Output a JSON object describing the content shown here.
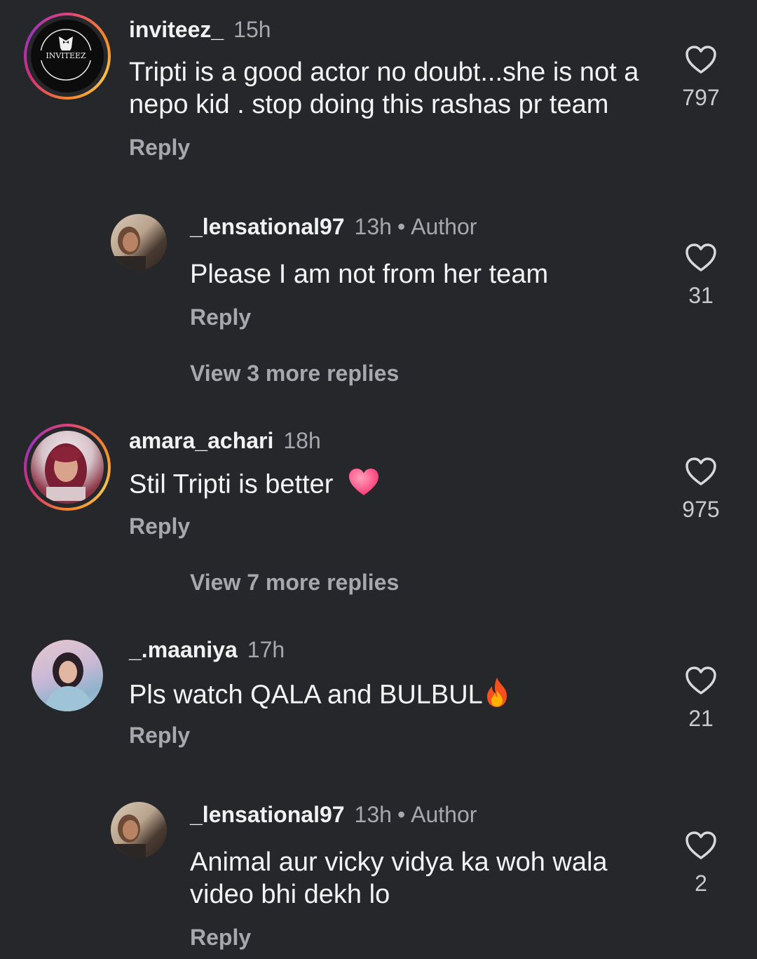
{
  "comments": [
    {
      "username": "inviteez_",
      "time": "15h",
      "text": "Tripti is a good actor no doubt...she is not a nepo kid . stop doing this rashas pr team",
      "reply_label": "Reply",
      "likes": "797",
      "avatar_text": "INVITEEZ"
    },
    {
      "username": "_lensational97",
      "time": "13h",
      "badge": "Author",
      "text": "Please I am not from her team",
      "reply_label": "Reply",
      "likes": "31",
      "view_more": "View 3 more replies"
    },
    {
      "username": "amara_achari",
      "time": "18h",
      "text": "Stil Tripti is better",
      "emoji": "heart-emoji",
      "reply_label": "Reply",
      "likes": "975",
      "view_more": "View 7 more replies"
    },
    {
      "username": "_.maaniya",
      "time": "17h",
      "text": "Pls watch QALA and BULBUL",
      "emoji": "fire-emoji",
      "reply_label": "Reply",
      "likes": "21"
    },
    {
      "username": "_lensational97",
      "time": "13h",
      "badge": "Author",
      "text": "Animal aur vicky vidya ka woh wala video bhi dekh lo",
      "reply_label": "Reply",
      "likes": "2"
    }
  ],
  "separator": "•",
  "colors": {
    "background": "#26272b",
    "primary_text": "#f4f4f4",
    "secondary_text": "#a6a8ad",
    "story_ring": "#f58529"
  }
}
